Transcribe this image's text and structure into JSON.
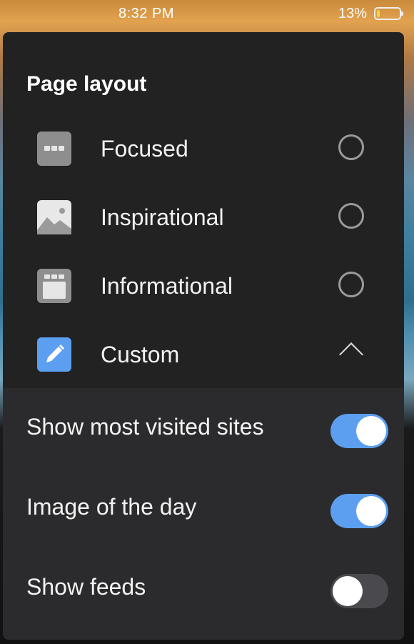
{
  "status_bar": {
    "time": "8:32 PM",
    "battery_percent": "13%",
    "battery_level": 0.13
  },
  "panel": {
    "title": "Page layout",
    "layouts": [
      {
        "label": "Focused",
        "icon": "focused-layout-icon",
        "selected": false
      },
      {
        "label": "Inspirational",
        "icon": "image-layout-icon",
        "selected": false
      },
      {
        "label": "Informational",
        "icon": "informational-layout-icon",
        "selected": false
      },
      {
        "label": "Custom",
        "icon": "pencil-icon",
        "expanded": true
      }
    ],
    "custom_options": [
      {
        "label": "Show most visited sites",
        "enabled": true
      },
      {
        "label": "Image of the day",
        "enabled": true
      },
      {
        "label": "Show feeds",
        "enabled": false
      }
    ]
  },
  "colors": {
    "panel_bg": "#222222",
    "section_bg": "#2b2b2d",
    "accent": "#5c9ff0",
    "toggle_off": "#4a4a4e",
    "custom_icon": "#5c9ff0"
  }
}
